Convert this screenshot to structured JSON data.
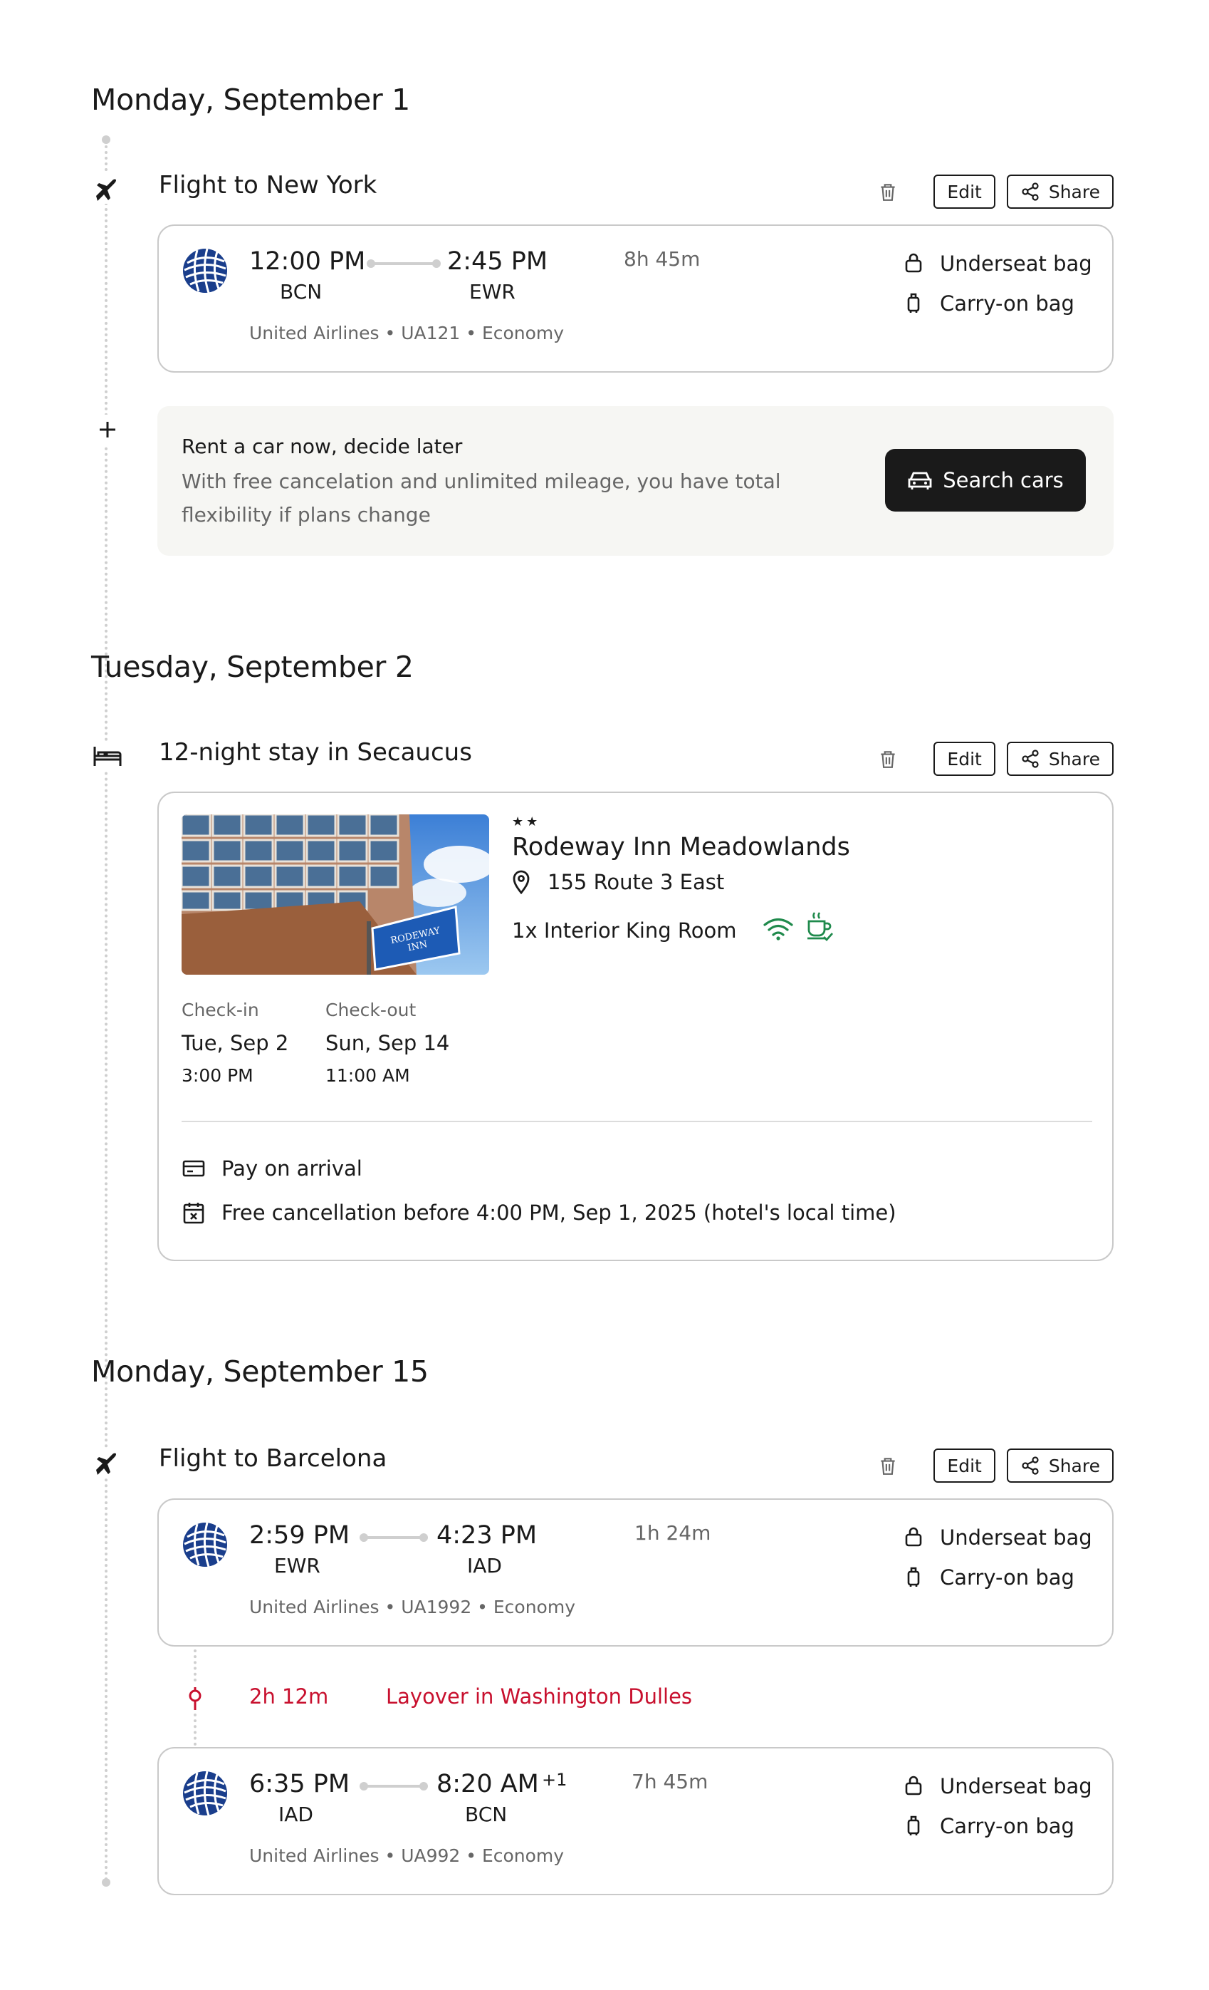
{
  "days": [
    {
      "date": "Monday, September 1",
      "flight": {
        "title": "Flight to New York",
        "segments": [
          {
            "depart_time": "12:00 PM",
            "depart_code": "BCN",
            "arrive_time": "2:45 PM",
            "arrive_code": "EWR",
            "day_offset": "",
            "duration": "8h 45m",
            "meta": "United Airlines • UA121 • Economy"
          }
        ]
      },
      "promo": {
        "title": "Rent a car now, decide later",
        "text": "With free cancelation and unlimited mileage, you have total flexibility if plans change",
        "button": "Search cars"
      }
    },
    {
      "date": "Tuesday, September 2",
      "stay": {
        "title": "12-night stay in Secaucus",
        "stars": "★★",
        "hotel_name": "Rodeway Inn Meadowlands",
        "address": "155 Route 3 East",
        "room": "1x Interior King Room",
        "sign_text": "RODEWAY INN",
        "checkin_label": "Check-in",
        "checkin_date": "Tue, Sep 2",
        "checkin_time": "3:00 PM",
        "checkout_label": "Check-out",
        "checkout_date": "Sun, Sep 14",
        "checkout_time": "11:00 AM",
        "payment": "Pay on arrival",
        "cancellation": "Free cancellation before 4:00 PM, Sep 1, 2025 (hotel's local time)"
      }
    },
    {
      "date": "Monday, September 15",
      "flight": {
        "title": "Flight to Barcelona",
        "segments": [
          {
            "depart_time": "2:59 PM",
            "depart_code": "EWR",
            "arrive_time": "4:23 PM",
            "arrive_code": "IAD",
            "day_offset": "",
            "duration": "1h 24m",
            "meta": "United Airlines • UA1992 • Economy"
          },
          {
            "depart_time": "6:35 PM",
            "depart_code": "IAD",
            "arrive_time": "8:20 AM",
            "arrive_code": "BCN",
            "day_offset": "+1",
            "duration": "7h 45m",
            "meta": "United Airlines • UA992 • Economy"
          }
        ],
        "layover": {
          "duration": "2h 12m",
          "text": "Layover in Washington Dulles"
        }
      }
    }
  ],
  "labels": {
    "edit": "Edit",
    "share": "Share",
    "underseat_bag": "Underseat bag",
    "carry_on_bag": "Carry-on bag"
  },
  "colors": {
    "accent_dark": "#1a1a1a",
    "layover": "#c8102e",
    "amenity": "#1f8a4c",
    "united_blue": "#1a3e8c"
  },
  "icons": [
    "plane-icon",
    "plus-icon",
    "bed-icon",
    "trash-icon",
    "share-icon",
    "car-icon",
    "lock-bag-icon",
    "suitcase-icon",
    "location-pin-icon",
    "wifi-icon",
    "breakfast-icon",
    "card-icon",
    "calendar-x-icon",
    "layover-pin-icon"
  ]
}
